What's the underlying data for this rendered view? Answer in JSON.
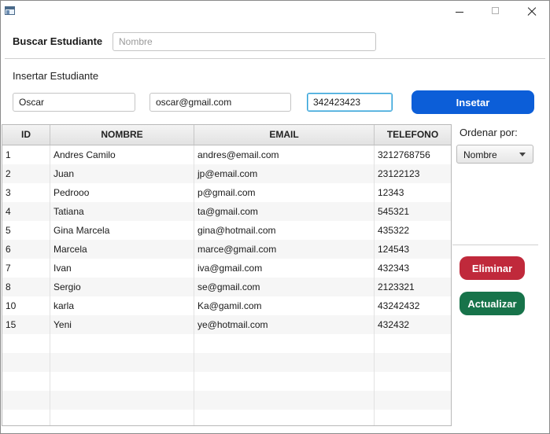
{
  "search": {
    "label": "Buscar Estudiante",
    "placeholder": "Nombre",
    "value": ""
  },
  "insert": {
    "label": "Insertar Estudiante",
    "name_value": "Oscar",
    "email_value": "oscar@gmail.com",
    "phone_value": "342423423",
    "button_label": "Insetar"
  },
  "sort": {
    "label": "Ordenar por:",
    "selected": "Nombre"
  },
  "actions": {
    "delete_label": "Eliminar",
    "update_label": "Actualizar"
  },
  "table": {
    "headers": [
      "ID",
      "NOMBRE",
      "EMAIL",
      "TELEFONO"
    ],
    "rows": [
      [
        "1",
        "Andres Camilo",
        "andres@email.com",
        "3212768756"
      ],
      [
        "2",
        "Juan",
        "jp@email.com",
        "23122123"
      ],
      [
        "3",
        "Pedrooo",
        "p@gmail.com",
        "12343"
      ],
      [
        "4",
        "Tatiana",
        "ta@gmail.com",
        "545321"
      ],
      [
        "5",
        "Gina Marcela",
        "gina@hotmail.com",
        "435322"
      ],
      [
        "6",
        "Marcela",
        "marce@gmail.com",
        "124543"
      ],
      [
        "7",
        "Ivan",
        "iva@gmail.com",
        "432343"
      ],
      [
        "8",
        "Sergio",
        "se@gmail.com",
        "2123321"
      ],
      [
        "10",
        "karla",
        "Ka@gamil.com",
        "43242432"
      ],
      [
        "15",
        "Yeni",
        "ye@hotmail.com",
        "432432"
      ]
    ]
  },
  "colors": {
    "insert_button": "#0c5ed8",
    "delete_button": "#c0293b",
    "update_button": "#17734a",
    "focus_ring": "#2f9fd6"
  },
  "icons": {
    "app": "app-window-icon",
    "minimize": "minimize-icon",
    "maximize": "maximize-icon",
    "close": "close-icon",
    "dropdown": "chevron-down-icon"
  }
}
